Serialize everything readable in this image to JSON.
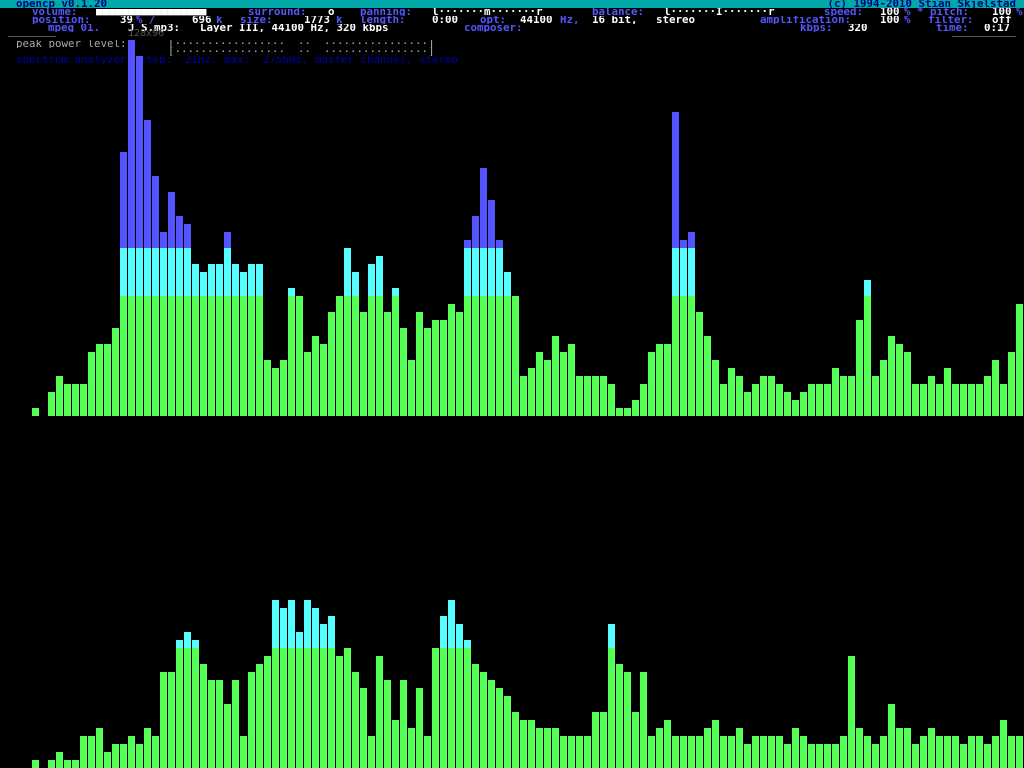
{
  "header": {
    "app_title": "opencp v0.1.20",
    "copyright": "(c) 1994-2010 Stian Skjelstad"
  },
  "status": {
    "volume_label": "volume:",
    "volume_bar": "■■■■■■■■■■■■■■■■■",
    "surround_label": "surround:",
    "surround_value": "o",
    "panning_label": "panning:",
    "panning_value": "l·······m·······r",
    "balance_label": "balance:",
    "balance_value": "l·······I·······r",
    "speed_label": "speed:",
    "speed_value": "100",
    "pitch_label": "% * pitch:",
    "pitch_value": "100",
    "percent": "%",
    "position_label": "position:",
    "position_value": "39",
    "position_sep": "% /",
    "position_total": "696",
    "k": "k",
    "size_label": "size:",
    "size_value": "1773",
    "length_label": "length:",
    "length_value": "0:00",
    "opt_label": "opt:",
    "opt_rate": "44100",
    "opt_hz": "Hz,",
    "opt_bits": "16 bit,",
    "opt_channels": "stereo",
    "amplification_label": "amplification:",
    "amplification_value": "100",
    "filter_label": "filter:",
    "filter_value": "off",
    "mpeg_label": "mpeg 01.",
    "file_name": "J S.mp3:",
    "file_info": "Layer III, 44100 Hz, 320 kbps",
    "composer_label": "composer:",
    "kbps_label": "kbps:",
    "kbps_value": "320",
    "time_label": "time:",
    "time_value": "0:17",
    "overlay_res": "128x96"
  },
  "peak": {
    "label": "peak power level:",
    "left_bar": "[·················  ··  ················]",
    "right_bar": "[·················  ··  ················]"
  },
  "analyzer": {
    "caption": "spectrum analyzer, step:  21Hz, max:  2756Hz, master channel, stereo"
  },
  "colors": {
    "green": "#55ff55",
    "cyan": "#55ffff",
    "blue": "#5555ff"
  },
  "top_bars": [
    1,
    0,
    3,
    5,
    4,
    4,
    4,
    8,
    9,
    9,
    11,
    33,
    47,
    45,
    37,
    30,
    23,
    28,
    25,
    24,
    19,
    18,
    19,
    19,
    23,
    19,
    18,
    19,
    19,
    7,
    6,
    7,
    16,
    15,
    8,
    10,
    9,
    13,
    15,
    21,
    18,
    13,
    19,
    20,
    13,
    16,
    11,
    7,
    13,
    11,
    12,
    12,
    14,
    13,
    22,
    25,
    31,
    27,
    22,
    18,
    15,
    5,
    6,
    8,
    7,
    10,
    8,
    9,
    5,
    5,
    5,
    5,
    4,
    1,
    1,
    2,
    4,
    8,
    9,
    9,
    38,
    22,
    23,
    13,
    10,
    7,
    4,
    6,
    5,
    3,
    4,
    5,
    5,
    4,
    3,
    2,
    3,
    4,
    4,
    4,
    6,
    5,
    5,
    12,
    17,
    5,
    7,
    10,
    9,
    8,
    4,
    4,
    5,
    4,
    6,
    4,
    4,
    4,
    4,
    5,
    7,
    4,
    8,
    14,
    8,
    7,
    3,
    4,
    7,
    5,
    13,
    10,
    6,
    11
  ],
  "bot_bars": [
    1,
    0,
    1,
    2,
    1,
    1,
    4,
    4,
    5,
    2,
    3,
    3,
    4,
    3,
    5,
    4,
    12,
    12,
    16,
    17,
    16,
    13,
    11,
    11,
    8,
    11,
    4,
    12,
    13,
    14,
    21,
    20,
    21,
    17,
    21,
    20,
    18,
    19,
    14,
    15,
    12,
    10,
    4,
    14,
    11,
    6,
    11,
    5,
    10,
    4,
    15,
    19,
    21,
    18,
    16,
    13,
    12,
    11,
    10,
    9,
    7,
    6,
    6,
    5,
    5,
    5,
    4,
    4,
    4,
    4,
    7,
    7,
    18,
    13,
    12,
    7,
    12,
    4,
    5,
    6,
    4,
    4,
    4,
    4,
    5,
    6,
    4,
    4,
    5,
    3,
    4,
    4,
    4,
    4,
    3,
    5,
    4,
    3,
    3,
    3,
    3,
    4,
    14,
    5,
    4,
    3,
    4,
    8,
    5,
    5,
    3,
    4,
    5,
    4,
    4,
    4,
    3,
    4,
    4,
    3,
    4,
    6,
    4,
    4,
    7,
    4,
    5,
    6,
    4,
    4,
    7,
    6,
    5,
    6
  ]
}
